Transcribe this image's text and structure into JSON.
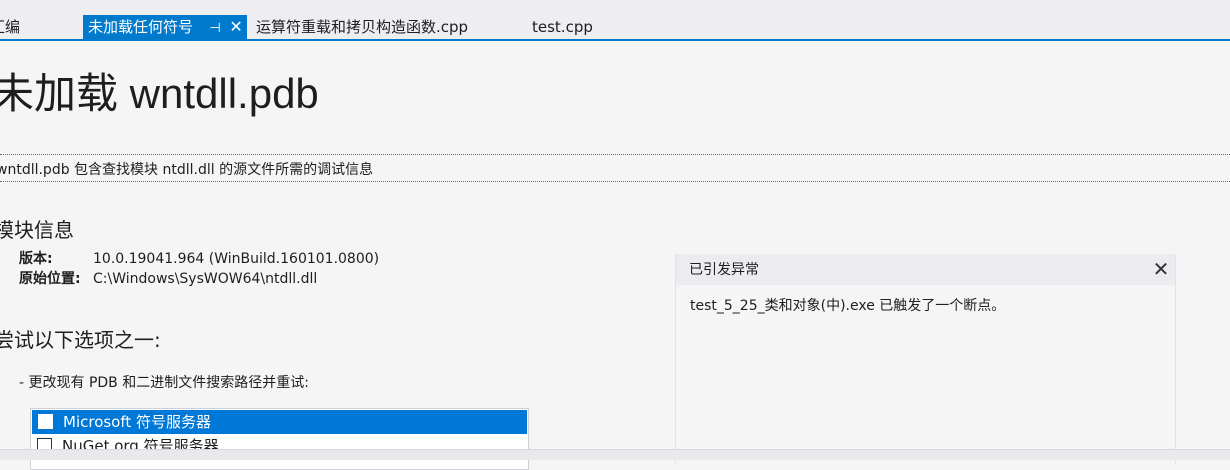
{
  "tabs": [
    {
      "label": "汇编",
      "active": false
    },
    {
      "label": "未加载任何符号",
      "active": true
    },
    {
      "label": "运算符重载和拷贝构造函数.cpp",
      "active": false
    },
    {
      "label": "test.cpp",
      "active": false
    }
  ],
  "tab_icons": {
    "pin": "pin-icon",
    "close": "close-icon"
  },
  "page": {
    "title": "未加载 wntdll.pdb",
    "description": "wntdll.pdb 包含查找模块 ntdll.dll 的源文件所需的调试信息",
    "module_section": "模块信息",
    "version_label": "版本:",
    "version_value": "10.0.19041.964 (WinBuild.160101.0800)",
    "location_label": "原始位置:",
    "location_value": "C:\\Windows\\SysWOW64\\ntdll.dll",
    "options_section": "尝试以下选项之一:",
    "option_bullet": "-  更改现有 PDB 和二进制文件搜索路径并重试:",
    "symbol_servers": [
      {
        "label": "Microsoft 符号服务器",
        "checked": false,
        "selected": true
      },
      {
        "label": "NuGet.org 符号服务器",
        "checked": false,
        "selected": false
      }
    ]
  },
  "exception_popup": {
    "title": "已引发异常",
    "message": "test_5_25_类和对象(中).exe 已触发了一个断点。",
    "close_icon": "close-icon"
  },
  "colors": {
    "accent": "#007acc",
    "selection": "#0078d7",
    "background": "#f5f5f5"
  }
}
